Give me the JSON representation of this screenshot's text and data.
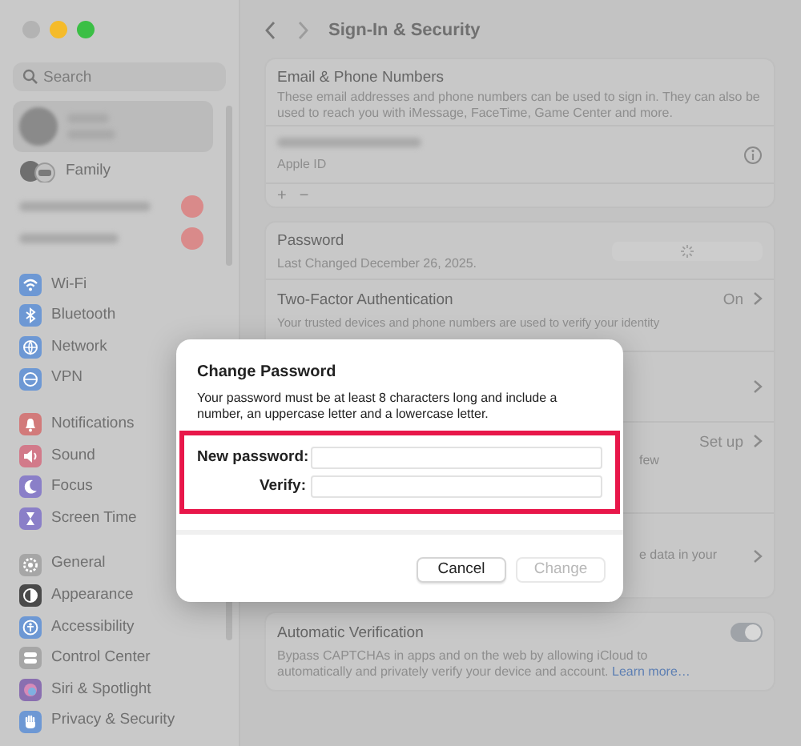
{
  "sidebar": {
    "search": {
      "placeholder": "Search"
    },
    "account": {
      "selected": true
    },
    "family": {
      "label": "Family"
    },
    "groups": [
      [
        {
          "label": "Wi-Fi",
          "color": "#6d98d4"
        },
        {
          "label": "Bluetooth",
          "color": "#6d98d4"
        },
        {
          "label": "Network",
          "color": "#6d98d4"
        },
        {
          "label": "VPN",
          "color": "#6d98d4"
        }
      ],
      [
        {
          "label": "Notifications",
          "color": "#d27a7a"
        },
        {
          "label": "Sound",
          "color": "#d27a8a"
        },
        {
          "label": "Focus",
          "color": "#8a7fc8"
        },
        {
          "label": "Screen Time",
          "color": "#8a7fc8"
        }
      ],
      [
        {
          "label": "General",
          "color": "#a6a6a6"
        },
        {
          "label": "Appearance",
          "color": "#4a4a4a"
        },
        {
          "label": "Accessibility",
          "color": "#6d98d4"
        },
        {
          "label": "Control Center",
          "color": "#a6a6a6"
        },
        {
          "label": "Siri & Spotlight",
          "color": "#8a6fb0"
        },
        {
          "label": "Privacy & Security",
          "color": "#6d98d4"
        }
      ]
    ]
  },
  "toolbar": {
    "title": "Sign-In & Security"
  },
  "email_card": {
    "title": "Email & Phone Numbers",
    "description": "These email addresses and phone numbers can be used to sign in. They can also be used to reach you with iMessage, FaceTime, Game Center and more.",
    "field_caption": "Apple ID",
    "add": "+",
    "remove": "−"
  },
  "security_card": {
    "rows": [
      {
        "title": "Password",
        "subtitle": "Last Changed December 26, 2025.",
        "busy": true
      },
      {
        "title": "Two-Factor Authentication",
        "subtitle": "Your trusted devices and phone numbers are used to verify your identity",
        "value": "On"
      },
      {
        "partial": "",
        "chevron": true
      },
      {
        "value": "Set up",
        "partial": "few",
        "chevron": true
      },
      {
        "partial": "e data in your",
        "chevron": true
      }
    ]
  },
  "verification_card": {
    "title": "Automatic Verification",
    "description": "Bypass CAPTCHAs in apps and on the web by allowing iCloud to automatically and privately verify your device and account.",
    "link": "Learn more…",
    "on": true
  },
  "dialog": {
    "title": "Change Password",
    "message": "Your password must be at least 8 characters long and include a number, an uppercase letter and a lowercase letter.",
    "highlight": true,
    "fields": [
      {
        "label": "New password:"
      },
      {
        "label": "Verify:"
      }
    ],
    "buttons": [
      {
        "label": "Cancel",
        "disabled": false
      },
      {
        "label": "Change",
        "disabled": true
      }
    ]
  }
}
